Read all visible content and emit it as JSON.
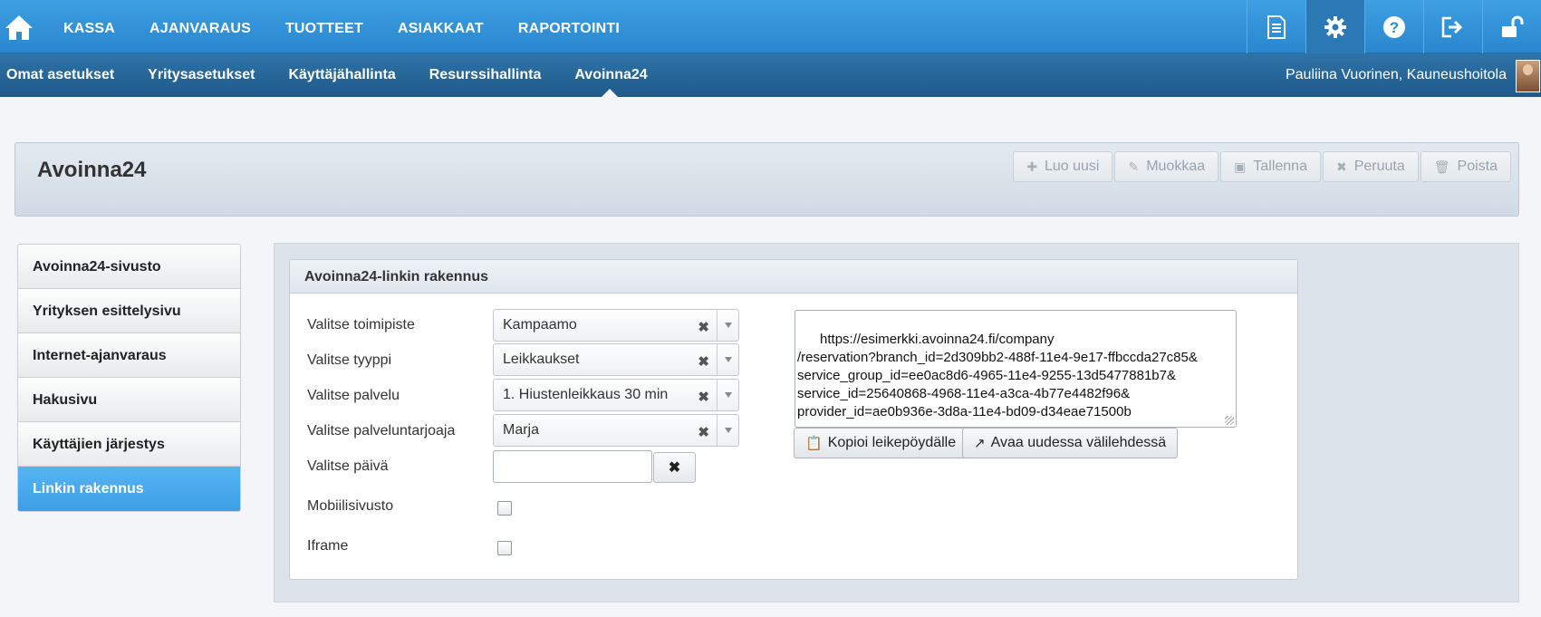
{
  "topnav": [
    "KASSA",
    "AJANVARAUS",
    "TUOTTEET",
    "ASIAKKAAT",
    "RAPORTOINTI"
  ],
  "topicons": [
    "document-icon",
    "gear-icon",
    "help-icon",
    "logout-icon",
    "unlock-icon"
  ],
  "subnav": [
    "Omat asetukset",
    "Yritysasetukset",
    "Käyttäjähallinta",
    "Resurssihallinta",
    "Avoinna24"
  ],
  "user": "Pauliina Vuorinen, Kauneushoitola",
  "page_title": "Avoinna24",
  "toolbar": [
    "Luo uusi",
    "Muokkaa",
    "Tallenna",
    "Peruuta",
    "Poista"
  ],
  "sidebar": [
    "Avoinna24-sivusto",
    "Yrityksen esittelysivu",
    "Internet-ajanvaraus",
    "Hakusivu",
    "Käyttäjien järjestys",
    "Linkin rakennus"
  ],
  "card_title": "Avoinna24-linkin rakennus",
  "form": {
    "toimipiste_label": "Valitse toimipiste",
    "toimipiste_value": "Kampaamo",
    "tyyppi_label": "Valitse tyyppi",
    "tyyppi_value": "Leikkaukset",
    "palvelu_label": "Valitse palvelu",
    "palvelu_value": "1. Hiustenleikkaus 30 min",
    "tarjoaja_label": "Valitse palveluntarjoaja",
    "tarjoaja_value": "Marja",
    "paiva_label": "Valitse päivä",
    "paiva_value": "",
    "mobiili_label": "Mobiilisivusto",
    "iframe_label": "Iframe"
  },
  "url_text": "https://esimerkki.avoinna24.fi/company\n/reservation?branch_id=2d309bb2-488f-11e4-9e17-ffbccda27c85&\nservice_group_id=ee0ac8d6-4965-11e4-9255-13d5477881b7&\nservice_id=25640868-4968-11e4-a3ca-4b77e4482f96&\nprovider_id=ae0b936e-3d8a-11e4-bd09-d34eae71500b",
  "copy_button": "Kopioi leikepöydälle",
  "open_button": "Avaa uudessa välilehdessä",
  "colors": {
    "top_bar": "#3e9fe3",
    "sub_bar": "#2f73a8",
    "active_sidebar": "#4aa9ec"
  }
}
